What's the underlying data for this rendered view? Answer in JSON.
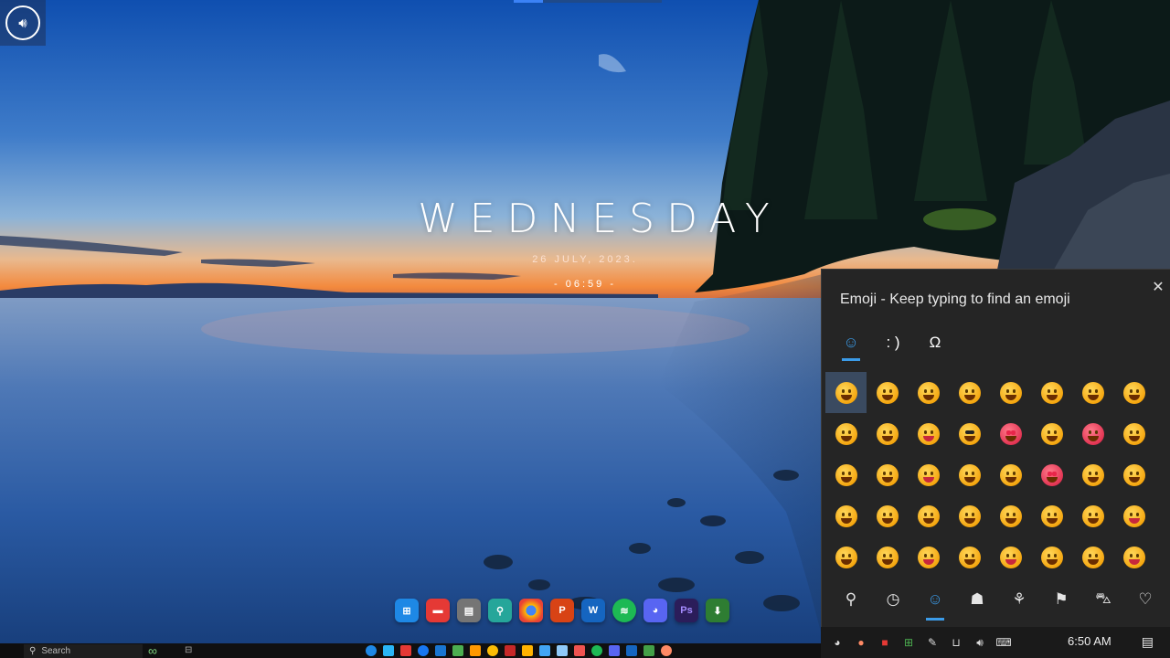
{
  "desktop": {
    "clock_widget": {
      "day": "WEDNESDAY",
      "date": "26 JULY, 2023.",
      "time": "- 06:59 -"
    }
  },
  "emoji_panel": {
    "title": "Emoji - Keep typing to find an emoji",
    "close_glyph": "✕",
    "tabs": [
      {
        "name": "emoji",
        "glyph": "☺"
      },
      {
        "name": "kaomoji",
        "glyph": ": )"
      },
      {
        "name": "symbols",
        "glyph": "Ω"
      }
    ],
    "categories": [
      {
        "name": "search-icon",
        "glyph": "⚲"
      },
      {
        "name": "recent-icon",
        "glyph": "◷"
      },
      {
        "name": "smiley-icon",
        "glyph": "☺"
      },
      {
        "name": "people-icon",
        "glyph": "☗"
      },
      {
        "name": "balloon-icon",
        "glyph": "⚘"
      },
      {
        "name": "food-icon",
        "glyph": "⚑"
      },
      {
        "name": "car-icon",
        "glyph": "⛍"
      },
      {
        "name": "heart-icon",
        "glyph": "♡"
      }
    ]
  },
  "taskbar": {
    "search_placeholder": "Search",
    "tray_time": "6:50 AM",
    "colors": {
      "accent": "#3b9be8",
      "panel_bg": "#252525",
      "taskbar_bg": "#101010"
    }
  }
}
